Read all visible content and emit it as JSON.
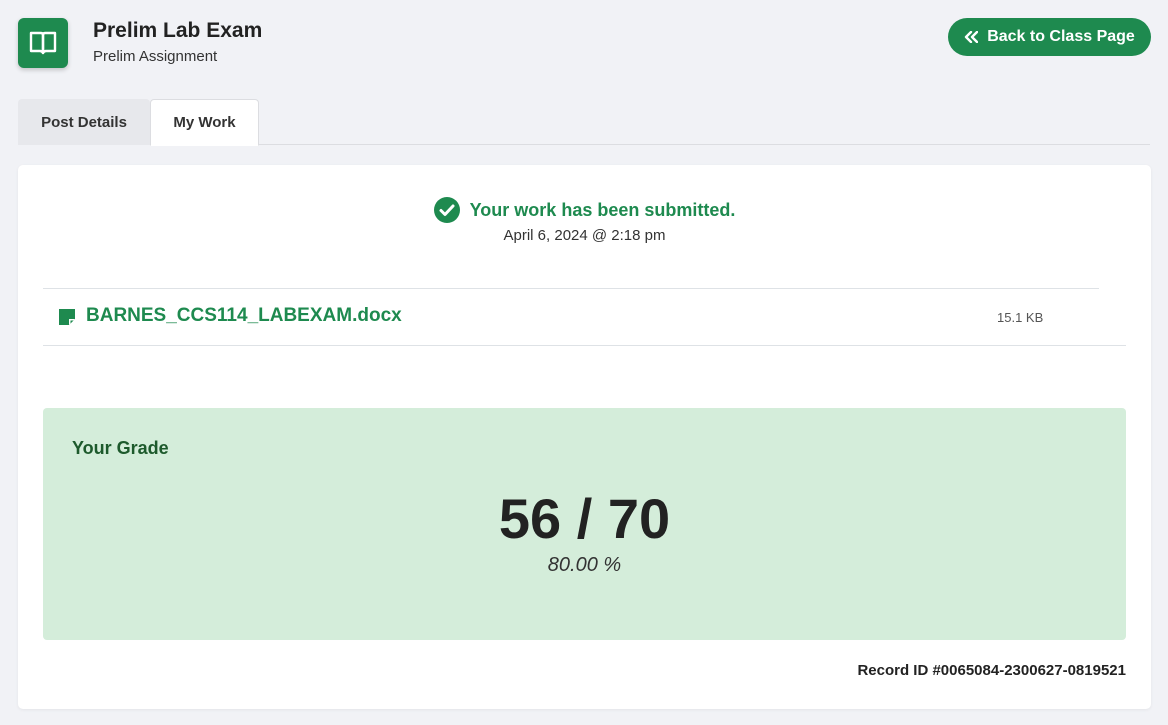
{
  "header": {
    "title": "Prelim Lab Exam",
    "subtitle": "Prelim Assignment",
    "back_button_label": "Back to Class Page",
    "logo_icon": "book-open-icon"
  },
  "tabs": [
    {
      "label": "Post Details",
      "active": false
    },
    {
      "label": "My Work",
      "active": true
    }
  ],
  "submission": {
    "status_text": "Your work has been submitted.",
    "date": "April 6, 2024 @ 2:18 pm",
    "status_icon": "check-circle-icon"
  },
  "file": {
    "name": "BARNES_CCS114_LABEXAM.docx",
    "size": "15.1 KB",
    "icon": "file-icon"
  },
  "grade": {
    "label": "Your Grade",
    "score": "56 / 70",
    "percent": "80.00 %"
  },
  "record_id": "Record ID #0065084-2300627-0819521",
  "colors": {
    "accent": "#1e8a4f",
    "grade_bg": "#d4edda",
    "page_bg": "#f1f2f6"
  }
}
